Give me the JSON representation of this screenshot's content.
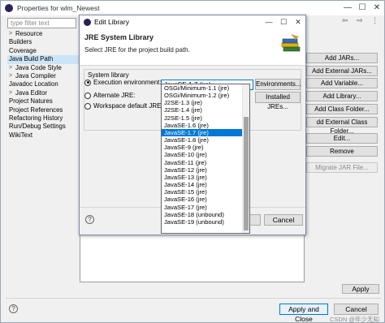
{
  "outer": {
    "title": "Properties for wlm_Newest",
    "filter_placeholder": "type filter text",
    "tree": [
      {
        "label": "Resource",
        "sub": true
      },
      {
        "label": "Builders",
        "sub": false
      },
      {
        "label": "Coverage",
        "sub": false
      },
      {
        "label": "Java Build Path",
        "sub": false,
        "selected": true
      },
      {
        "label": "Java Code Style",
        "sub": true
      },
      {
        "label": "Java Compiler",
        "sub": true
      },
      {
        "label": "Javadoc Location",
        "sub": false
      },
      {
        "label": "Java Editor",
        "sub": true
      },
      {
        "label": "Project Natures",
        "sub": false
      },
      {
        "label": "Project References",
        "sub": false
      },
      {
        "label": "Refactoring History",
        "sub": false
      },
      {
        "label": "Run/Debug Settings",
        "sub": false
      },
      {
        "label": "WikiText",
        "sub": false
      }
    ],
    "side_buttons": [
      {
        "label": "Add JARs...",
        "enabled": true
      },
      {
        "label": "Add External JARs...",
        "enabled": true
      },
      {
        "label": "Add Variable...",
        "enabled": true
      },
      {
        "label": "Add Library...",
        "enabled": true
      },
      {
        "label": "Add Class Folder...",
        "enabled": true
      },
      {
        "label": "dd External Class Folder...",
        "enabled": true
      },
      {
        "label": "Edit...",
        "enabled": true
      },
      {
        "label": "Remove",
        "enabled": true
      },
      {
        "label": "Migrate JAR File...",
        "enabled": false
      }
    ],
    "apply_label": "Apply",
    "apply_close_label": "Apply and Close",
    "cancel_label": "Cancel",
    "help_glyph": "?",
    "watermark": "CSDN @年少无知"
  },
  "dialog": {
    "title": "Edit Library",
    "banner_heading": "JRE System Library",
    "banner_subtitle": "Select JRE for the project build path.",
    "group_label": "System library",
    "execution_env_label": "Execution environment:",
    "alternate_jre_label": "Alternate JRE:",
    "workspace_default_label": "Workspace default JRE (jre)",
    "selected_env": "JavaSE-1.7 (jre)",
    "environments_button": "Environments...",
    "installed_jres_button": "Installed JREs...",
    "cancel_label": "Cancel",
    "help_glyph": "?"
  },
  "dropdown_options": [
    "OSGi/Minimum-1.1 (jre)",
    "OSGi/Minimum-1.2 (jre)",
    "J2SE-1.3 (jre)",
    "J2SE-1.4 (jre)",
    "J2SE-1.5 (jre)",
    "JavaSE-1.6 (jre)",
    "JavaSE-1.7 (jre)",
    "JavaSE-1.8 (jre)",
    "JavaSE-9 (jre)",
    "JavaSE-10 (jre)",
    "JavaSE-11 (jre)",
    "JavaSE-12 (jre)",
    "JavaSE-13 (jre)",
    "JavaSE-14 (jre)",
    "JavaSE-15 (jre)",
    "JavaSE-16 (jre)",
    "JavaSE-17 (jre)",
    "JavaSE-18 (unbound)",
    "JavaSE-19 (unbound)"
  ],
  "dropdown_selected_index": 6,
  "colors": {
    "selection": "#0078d7",
    "tree_selection": "#cce4f7",
    "eclipse_icon": "#2c2255"
  }
}
